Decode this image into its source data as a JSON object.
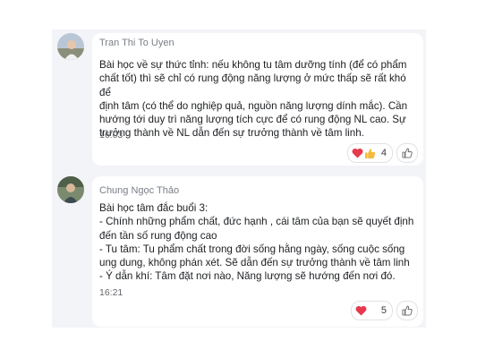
{
  "comments": [
    {
      "author": "Tran Thi To Uyen",
      "body": "Bài học về sự thức tỉnh: nếu không tu tâm dưỡng tính (để có phẩm\nchất tốt) thì sẽ chỉ có rung động năng lượng ở mức thấp sẽ rất khó để\nđịnh tâm (có thể do nghiệp quả, nguồn năng lượng dính mắc).  Cần\nhướng tới duy trì năng lượng tích cực để có rung động NL cao. Sự\ntrưởng thành về NL dẫn đến sự trưởng thành về tâm linh.",
      "time": "16:03",
      "reactions": [
        "heart-icon",
        "thumbs-up-icon"
      ],
      "reaction_count": "4"
    },
    {
      "author": "Chung Ngọc Thảo",
      "body": "Bài học tâm đắc buổi 3:\n- Chính những phẩm chất, đức hạnh , cái tâm của bạn sẽ quyết định\nđến tần số rung động cao\n- Tu tâm: Tu phẩm chất trong đời sống hằng ngày, sống cuộc sống\nung dung, không phán xét. Sẽ dẫn đến sự trưởng thành về tâm linh\n- Ý dẫn khí: Tâm đặt nơi nào, Năng lượng sẽ hướng đến nơi đó.",
      "time": "16:21",
      "reactions": [
        "heart-icon"
      ],
      "reaction_count": "5"
    }
  ],
  "colors": {
    "heart": "#e8394d",
    "thumb": "#f5b93b",
    "card_bg": "#ffffff",
    "thread_bg": "#f3f4f7"
  }
}
